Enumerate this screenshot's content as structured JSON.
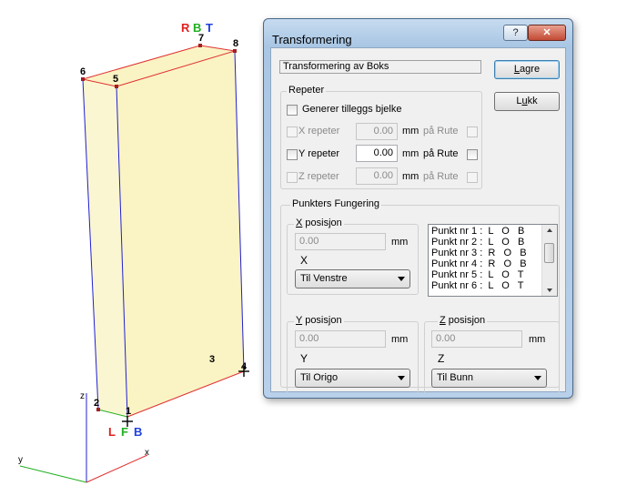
{
  "scene": {
    "corner_top_labels": [
      "R",
      "B",
      "T"
    ],
    "corner_bottom_labels": [
      "L",
      "F",
      "B"
    ],
    "point_numbers": [
      "1",
      "2",
      "3",
      "4",
      "5",
      "6",
      "7",
      "8"
    ],
    "axes": {
      "x": "x",
      "y": "y",
      "z": "z"
    },
    "colors": {
      "box_fill": "#faf3c4",
      "edge_red": "#e03030",
      "edge_blue": "#2020d0",
      "axis_green": "#20b020"
    }
  },
  "dialog": {
    "title": "Transformering",
    "help_label": "?",
    "close_label": "✕",
    "subtitle": "Transformering av Boks",
    "save_label": "Lagre",
    "close_button_label": "Lukk",
    "repeat": {
      "group_title": "Repeter",
      "extra_beam_label": "Generer tilleggs bjelke",
      "rows": [
        {
          "label": "X repeter",
          "value": "0.00",
          "unit": "mm",
          "route_label": "på Rute"
        },
        {
          "label": "Y repeter",
          "value": "0.00",
          "unit": "mm",
          "route_label": "på Rute"
        },
        {
          "label": "Z repeter",
          "value": "0.00",
          "unit": "mm",
          "route_label": "på Rute"
        }
      ]
    },
    "points": {
      "group_title": "Punkters Fungering",
      "x_group": {
        "title": "X posisjon",
        "value": "0.00",
        "unit": "mm",
        "axis": "X",
        "selected": "Til Venstre"
      },
      "y_group": {
        "title": "Y posisjon",
        "value": "0.00",
        "unit": "mm",
        "axis": "Y",
        "selected": "Til Origo"
      },
      "z_group": {
        "title": "Z posisjon",
        "value": "0.00",
        "unit": "mm",
        "axis": "Z",
        "selected": "Til Bunn"
      },
      "list": [
        "Punkt nr 1 :  L   O   B",
        "Punkt nr 2 :  L   O   B",
        "Punkt nr 3 :  R   O   B",
        "Punkt nr 4 :  R   O   B",
        "Punkt nr 5 :  L   O   T",
        "Punkt nr 6 :  L   O   T"
      ]
    }
  }
}
